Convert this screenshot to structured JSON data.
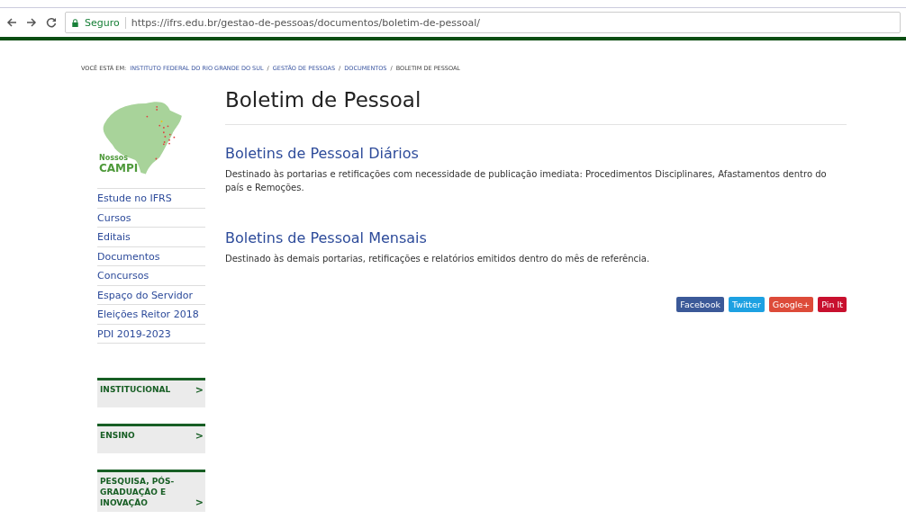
{
  "browser": {
    "secure_label": "Seguro",
    "url": "https://ifrs.edu.br/gestao-de-pessoas/documentos/boletim-de-pessoal/"
  },
  "breadcrumb": {
    "prefix": "VOCÊ ESTÁ EM:",
    "separator": "/",
    "items": [
      {
        "label": "INSTITUTO FEDERAL DO RIO GRANDE DO SUL",
        "link": true
      },
      {
        "label": "GESTÃO DE PESSOAS",
        "link": true
      },
      {
        "label": "DOCUMENTOS",
        "link": true
      },
      {
        "label": "BOLETIM DE PESSOAL",
        "link": false
      }
    ]
  },
  "sidebar": {
    "map": {
      "line1": "Nossos",
      "line2": "CAMPI"
    },
    "items": [
      "Estude no IFRS",
      "Cursos",
      "Editais",
      "Documentos",
      "Concursos",
      "Espaço do Servidor",
      "Eleições Reitor 2018",
      "PDI 2019-2023"
    ],
    "sections": [
      {
        "label": "INSTITUCIONAL",
        "arrow": ">"
      },
      {
        "label": "ENSINO",
        "arrow": ">"
      },
      {
        "label": "PESQUISA, PÓS-GRADUAÇÃO E INOVAÇÃO",
        "arrow": ">"
      }
    ]
  },
  "page": {
    "title": "Boletim de Pessoal",
    "sections": [
      {
        "heading": "Boletins de Pessoal Diários",
        "text": "Destinado às portarias e retificações com necessidade de publicação imediata: Procedimentos Disciplinares, Afastamentos dentro do país e Remoções."
      },
      {
        "heading": "Boletins de Pessoal Mensais",
        "text": "Destinado às demais portarias, retificações e relatórios emitidos dentro do mês de referência."
      }
    ],
    "share": [
      {
        "label": "Facebook",
        "color": "#3b5998"
      },
      {
        "label": "Twitter",
        "color": "#1da1e2"
      },
      {
        "label": "Google+",
        "color": "#dd4b39"
      },
      {
        "label": "Pin It",
        "color": "#c8102e"
      }
    ]
  }
}
